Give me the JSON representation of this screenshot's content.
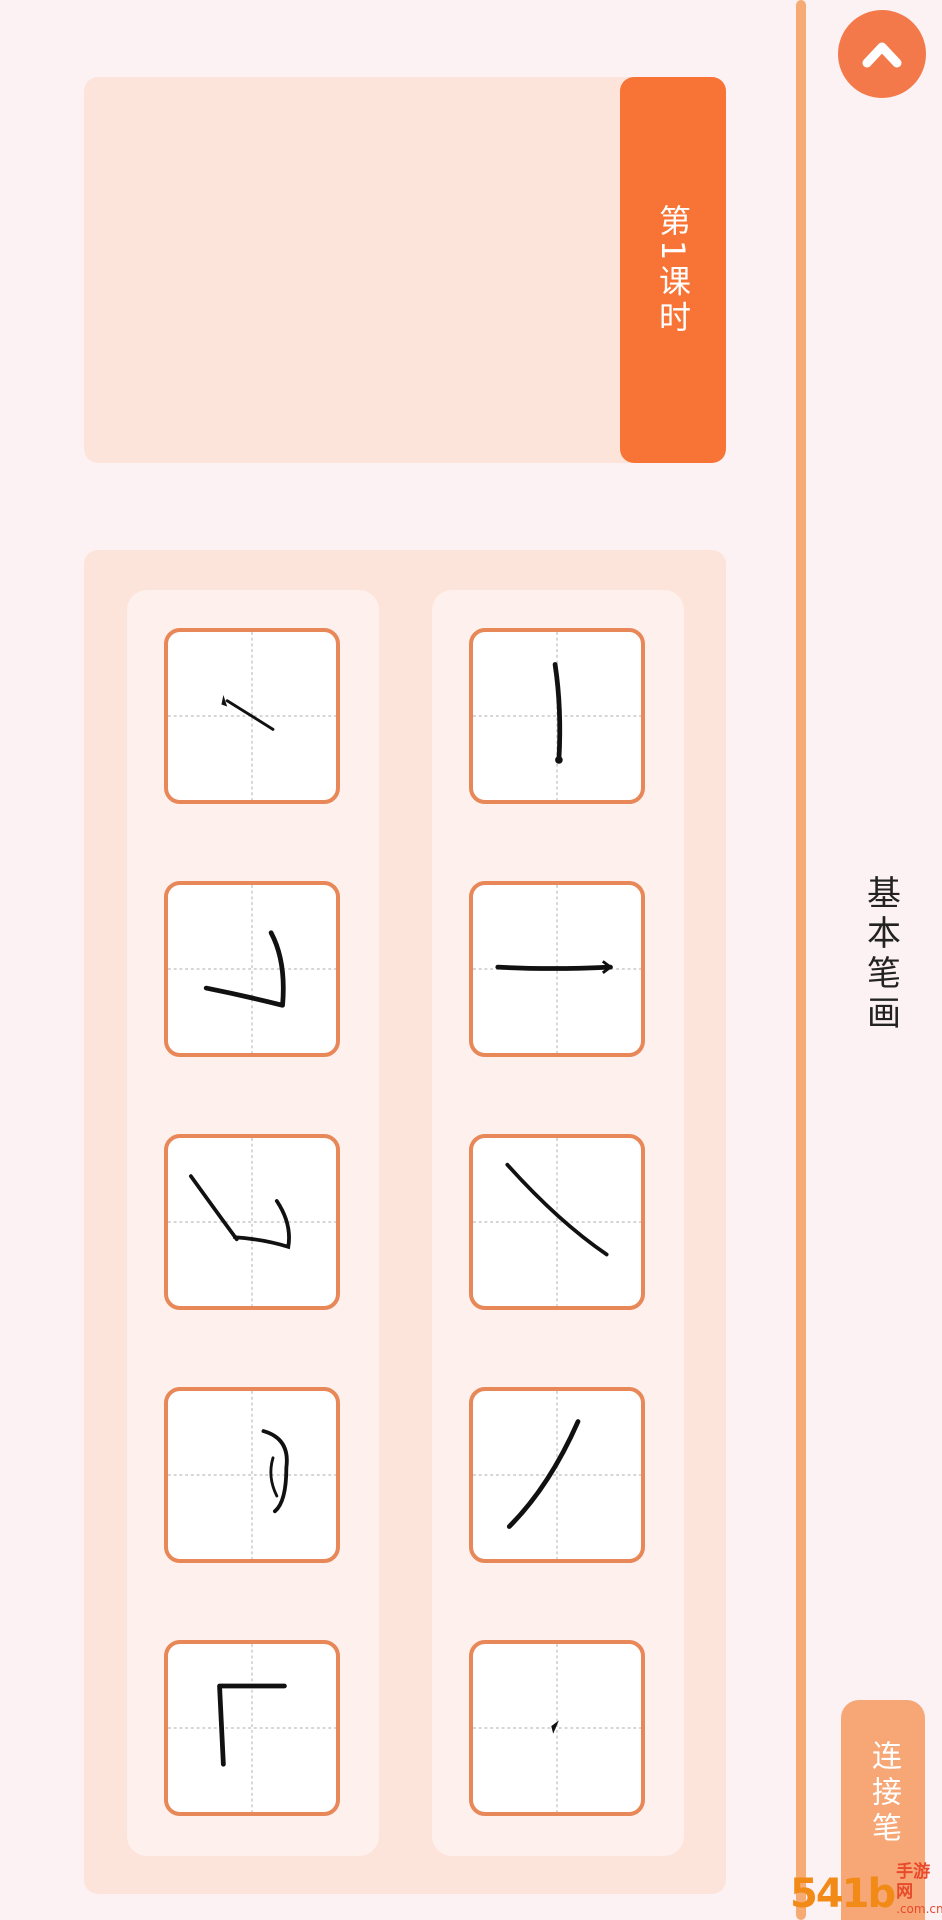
{
  "sidebar": {
    "title": "基本笔画",
    "connect_label": "连接笔",
    "up_icon": "chevron-up-icon"
  },
  "lesson": {
    "tab_label": "第1课时"
  },
  "strokes": {
    "columns": [
      {
        "cells": [
          {
            "icon": "stroke-heng"
          },
          {
            "icon": "stroke-shu"
          },
          {
            "icon": "stroke-pie"
          },
          {
            "icon": "stroke-na"
          },
          {
            "icon": "stroke-dian"
          }
        ]
      },
      {
        "cells": [
          {
            "icon": "stroke-ti"
          },
          {
            "icon": "stroke-hengzhe"
          },
          {
            "icon": "stroke-hengpie"
          },
          {
            "icon": "stroke-hengzhegou"
          },
          {
            "icon": "stroke-shuzhe"
          }
        ]
      }
    ]
  },
  "colors": {
    "accent": "#f77436",
    "panel": "#fde4da",
    "cell_border": "#e88758",
    "background": "#fcf1f3"
  },
  "watermark": {
    "main": "54",
    "mid": "1b",
    "top": "手游网",
    "bottom": ".com.cn"
  }
}
